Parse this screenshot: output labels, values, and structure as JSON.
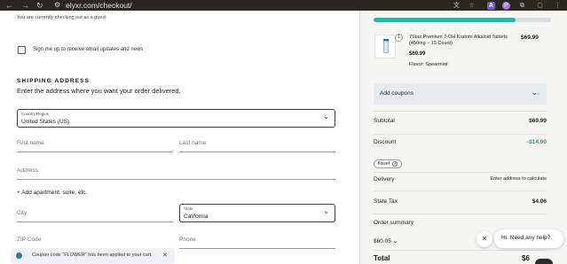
{
  "browser": {
    "url": "elyxr.com/checkout/",
    "extensions": [
      "A",
      "P"
    ]
  },
  "checkout": {
    "guest_note": "You are currently checking out as a guest",
    "newsletter_label": "Sign me up to receive email updates and news",
    "shipping_heading": "SHIPPING ADDRESS",
    "shipping_sub": "Enter the address where you want your order delivered.",
    "country": {
      "label": "Country/Region",
      "value": "United States (US)"
    },
    "first_name_ph": "First name",
    "last_name_ph": "Last name",
    "address_ph": "Address",
    "add_apartment": "+ Add apartment, suite, etc.",
    "city_ph": "City",
    "state": {
      "label": "State",
      "value": "California"
    },
    "zip_ph": "ZIP Code",
    "phone_ph": "Phone",
    "toast": "Coupon code \"FLOWER\" has been applied to your cart."
  },
  "summary": {
    "progress_percent": 80,
    "product": {
      "qty": "1",
      "name": "7Stax Premium 7-OH Kratom Alkaloid Tablets (450mg – 15 Count)",
      "price": "$69.99",
      "subtotal": "$69.99",
      "flavor_label": "Flavor:",
      "flavor_value": "Spearmint"
    },
    "coupons_label": "Add coupons",
    "subtotal_label": "Subtotal",
    "subtotal_value": "$69.99",
    "discount_label": "Discount",
    "discount_value": "-$14.00",
    "coupon_chip": "flower",
    "delivery_label": "Delivery",
    "delivery_value": "Enter address to calculate",
    "tax_label": "State Tax",
    "tax_value": "$4.06",
    "order_summary_label": "Order summary",
    "order_summary_amount": "$60.05",
    "total_label": "Total",
    "total_value": "$6"
  },
  "chat": {
    "greeting": "Hi. Need any help?"
  },
  "colors": {
    "accent": "#2bb5a0",
    "discount": "#2e9e4a",
    "chrome": "#2b2622"
  }
}
